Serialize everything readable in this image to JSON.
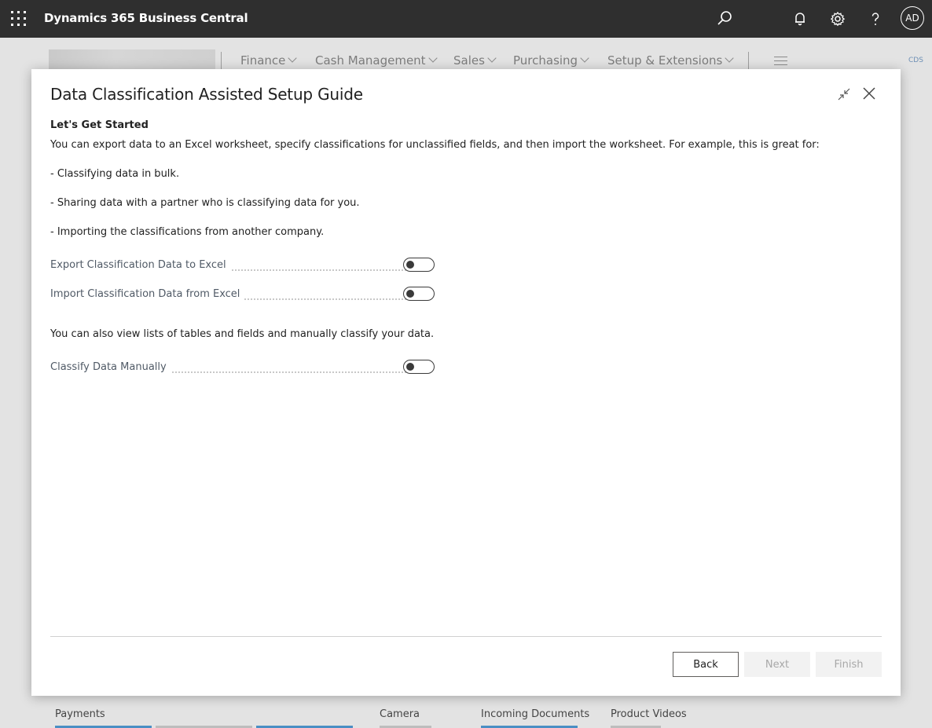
{
  "app": {
    "title": "Dynamics 365 Business Central",
    "user_initials": "AD"
  },
  "nav": {
    "items": [
      {
        "label": "Finance"
      },
      {
        "label": "Cash Management"
      },
      {
        "label": "Sales"
      },
      {
        "label": "Purchasing"
      },
      {
        "label": "Setup & Extensions"
      }
    ],
    "cds_label": "CDS"
  },
  "background": {
    "bottom_tabs": [
      "Payments",
      "Camera",
      "Incoming Documents",
      "Product Videos"
    ]
  },
  "dialog": {
    "title": "Data Classification Assisted Setup Guide",
    "section_title": "Let's Get Started",
    "intro": "You can export data to an Excel worksheet, specify classifications for unclassified fields, and then import the worksheet. For example, this is great for:",
    "bullets": [
      "- Classifying data in bulk.",
      "- Sharing data with a partner who is classifying data for you.",
      "- Importing the classifications from another company."
    ],
    "fields": [
      {
        "label": "Export Classification Data to Excel",
        "value": false
      },
      {
        "label": "Import Classification Data from Excel",
        "value": false
      }
    ],
    "manual_text": "You can also view lists of tables and fields and manually classify your data.",
    "manual_field": {
      "label": "Classify Data Manually",
      "value": false
    },
    "buttons": {
      "back": "Back",
      "next": "Next",
      "finish": "Finish"
    }
  }
}
